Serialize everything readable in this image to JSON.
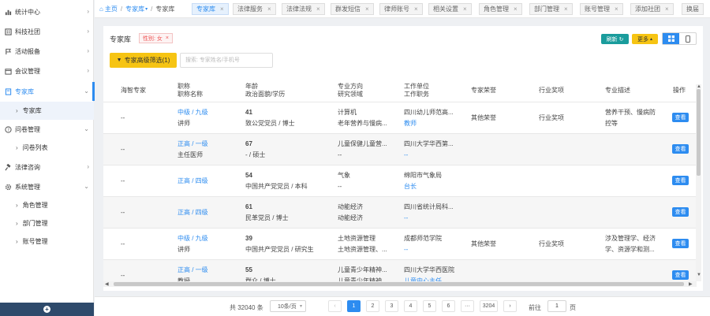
{
  "sidebar": {
    "items": [
      {
        "label": "统计中心",
        "icon": "bar-chart-icon"
      },
      {
        "label": "科技社团",
        "icon": "building-icon"
      },
      {
        "label": "活动报备",
        "icon": "flag-icon"
      },
      {
        "label": "会议管理",
        "icon": "calendar-icon"
      },
      {
        "label": "专家库",
        "icon": "book-icon"
      },
      {
        "label": "问卷管理",
        "icon": "question-icon"
      },
      {
        "label": "法律咨询",
        "icon": "gavel-icon"
      },
      {
        "label": "系统管理",
        "icon": "gear-icon"
      }
    ],
    "subitems": {
      "expert": "专家库",
      "survey": "问卷列表",
      "role": "角色管理",
      "dept": "部门管理",
      "account": "账号管理"
    }
  },
  "breadcrumb": {
    "home": "主页",
    "parent": "专家库",
    "current": "专家库"
  },
  "tabs": [
    "专家库",
    "法律服务",
    "法律法规",
    "群发短信",
    "律师账号",
    "相关设置",
    "角色管理",
    "部门管理",
    "账号管理",
    "添加社团",
    "换届"
  ],
  "page": {
    "title": "专家库",
    "filter_tag": "性别: 女",
    "refresh_label": "刷新",
    "more_label": "更多",
    "advanced_filter_label": "专家高级筛选(1)",
    "search_placeholder": "搜索: 专家姓名/手机号",
    "view_label": "查看"
  },
  "table": {
    "headers": {
      "h1": "海智专家",
      "h2a": "职称",
      "h2b": "职称名称",
      "h3a": "年龄",
      "h3b": "政治面貌/学历",
      "h4a": "专业方向",
      "h4b": "研究领域",
      "h5a": "工作单位",
      "h5b": "工作职务",
      "h6": "专家荣誉",
      "h7": "行业奖项",
      "h8": "专业描述",
      "h9": "操作"
    },
    "rows": [
      {
        "haizhi": "--",
        "title": "中级 / 九级",
        "title_name": "讲师",
        "age": "41",
        "political": "致公党党员 / 博士",
        "major": "计算机",
        "field": "老年营养与慢病...",
        "org": "四川幼儿师范高...",
        "duty": "教师",
        "honor": "其他荣誉",
        "award": "行业奖项",
        "desc1": "营养干预、慢病防",
        "desc2": "控等"
      },
      {
        "haizhi": "--",
        "title": "正高 / 一级",
        "title_name": "主任医师",
        "age": "67",
        "political": "- / 硕士",
        "major": "儿童保健儿童营...",
        "field": "--",
        "org": "四川大学华西第...",
        "duty": "--",
        "honor": "",
        "award": "",
        "desc1": "",
        "desc2": ""
      },
      {
        "haizhi": "--",
        "title": "正高 / 四级",
        "title_name": "",
        "age": "54",
        "political": "中国共产党党员 / 本科",
        "major": "气象",
        "field": "--",
        "org": "绵阳市气象局",
        "duty": "台长",
        "honor": "",
        "award": "",
        "desc1": "",
        "desc2": ""
      },
      {
        "haizhi": "--",
        "title": "正高 / 四级",
        "title_name": "",
        "age": "61",
        "political": "民革党员 / 博士",
        "major": "动能经济",
        "field": "动能经济",
        "org": "四川省统计局科...",
        "duty": "--",
        "honor": "",
        "award": "",
        "desc1": "",
        "desc2": ""
      },
      {
        "haizhi": "--",
        "title": "中级 / 九级",
        "title_name": "讲师",
        "age": "39",
        "political": "中国共产党党员 / 研究生",
        "major": "土地资源管理",
        "field": "土地资源管理、...",
        "org": "成都师范学院",
        "duty": "--",
        "honor": "其他荣誉",
        "award": "行业奖项",
        "desc1": "涉及管理学、经济",
        "desc2": "学、资源学和测..."
      },
      {
        "haizhi": "--",
        "title": "正高 / 一级",
        "title_name": "教授",
        "age": "55",
        "political": "群众 / 博士",
        "major": "儿童青少年精神...",
        "field": "儿童青少年精神...",
        "org": "四川大学华西医院",
        "duty": "儿童中心主任",
        "honor": "",
        "award": "",
        "desc1": "",
        "desc2": ""
      }
    ]
  },
  "pagination": {
    "total": "共 32040 条",
    "page_size": "10条/页",
    "pages": [
      "1",
      "2",
      "3",
      "4",
      "5",
      "6",
      "···",
      "3204"
    ],
    "goto_label": "前往",
    "goto_value": "1",
    "page_unit": "页"
  },
  "colors": {
    "primary": "#2d8cf0",
    "warning": "#f6c413",
    "teal": "#1a9c9c",
    "sidebar_bottom": "#2e4a6b"
  }
}
